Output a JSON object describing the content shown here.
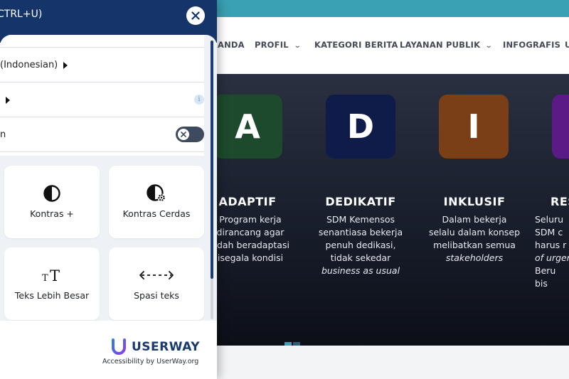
{
  "site": {
    "nav": [
      {
        "label": "ANDA",
        "has_dropdown": false
      },
      {
        "label": "PROFIL",
        "has_dropdown": true
      },
      {
        "label": "KATEGORI BERITA",
        "has_dropdown": false
      },
      {
        "label": "LAYANAN PUBLIK",
        "has_dropdown": true
      },
      {
        "label": "INFOGRAFIS",
        "has_dropdown": false
      },
      {
        "label": "U",
        "has_dropdown": false
      }
    ],
    "nav_caret": "⌄",
    "values": [
      {
        "letter": "A",
        "title": "ADAPTIF",
        "desc": "Program kerja\ndirancang agar\nudah beradaptasi\nisegala kondisi",
        "desc_em": "",
        "color": "#1d4a2c"
      },
      {
        "letter": "D",
        "title": "DEDIKATIF",
        "desc": "SDM Kemensos\nsenantiasa bekerja\npenuh dedikasi,\ntidak sekedar",
        "desc_em": "business as usual",
        "color": "#0f1c4a"
      },
      {
        "letter": "I",
        "title": "INKLUSIF",
        "desc": "Dalam bekerja\nselalu dalam konsep\nmelibatkan semua",
        "desc_em": "stakeholders",
        "color": "#7a3f17"
      },
      {
        "letter": "",
        "title": "RES",
        "desc": "Seluru\nSDM c\nharus r",
        "desc_em": "of urgen",
        "desc_after": "Beru\nbis",
        "color": "#5b1a86"
      }
    ]
  },
  "widget": {
    "header_title": "CTRL+U)",
    "close_icon": "close-icon",
    "rows": [
      {
        "label": "(Indonesian)",
        "has_caret": true
      },
      {
        "label": "",
        "has_caret": true,
        "has_info": true,
        "info_glyph": "i"
      },
      {
        "label": "n",
        "has_toggle": true,
        "toggle_state": "off"
      }
    ],
    "tiles": [
      {
        "label": "Kontras +",
        "icon": "contrast-icon"
      },
      {
        "label": "Kontras Cerdas",
        "icon": "smart-contrast-icon"
      },
      {
        "label": "Teks Lebih Besar",
        "icon": "bigger-text-icon"
      },
      {
        "label": "Spasi teks",
        "icon": "text-spacing-icon"
      }
    ],
    "footer": {
      "brand": "USERWAY",
      "tagline": "Accessibility by UserWay.org"
    }
  },
  "colors": {
    "widget_header": "#15346a",
    "site_topbar": "#3aa0b3",
    "accent_blue": "#1a3a6e"
  }
}
